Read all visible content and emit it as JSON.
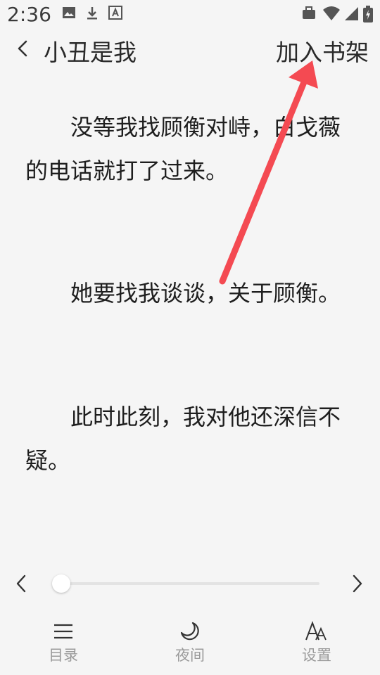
{
  "status_bar": {
    "time": "2:36",
    "icons": [
      "image-icon",
      "download-icon",
      "font-icon",
      "briefcase-icon",
      "wifi-icon",
      "signal-icon",
      "battery-icon"
    ]
  },
  "header": {
    "title": "小丑是我",
    "add_to_shelf": "加入书架"
  },
  "content": {
    "paragraphs": [
      "没等我找顾衡对峙，白戈薇的电话就打了过来。",
      "她要找我谈谈，关于顾衡。",
      "此时此刻，我对他还深信不疑。"
    ]
  },
  "progress": {
    "position": 0
  },
  "bottom_nav": {
    "catalog": "目录",
    "night": "夜间",
    "settings": "设置"
  },
  "annotation": {
    "arrow_color": "#f44a52"
  }
}
